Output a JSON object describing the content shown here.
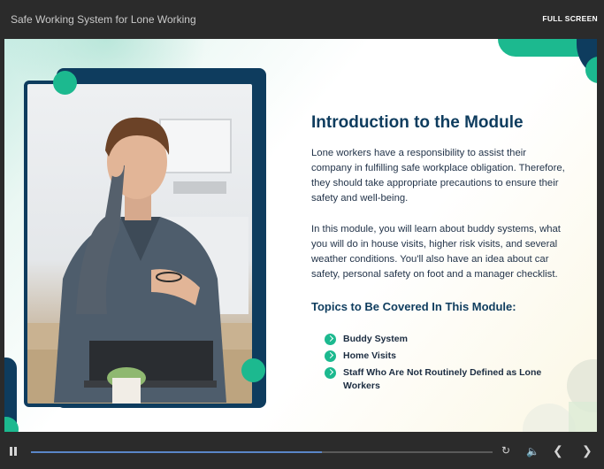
{
  "header": {
    "title": "Safe Working System for Lone Working",
    "fullscreen_label": "FULL SCREEN"
  },
  "slide": {
    "heading": "Introduction to the Module",
    "paragraph1": "Lone workers have a responsibility to assist their company in fulfilling safe workplace obligation. Therefore, they should take appropriate precautions to ensure their safety and well-being.",
    "paragraph2": "In this module, you will learn about buddy systems, what you will do in house visits, higher risk visits, and several weather conditions. You'll also have an idea about car safety, personal safety on foot and a manager checklist.",
    "topics_heading": "Topics to Be Covered In This Module:",
    "topics": [
      "Buddy System",
      "Home Visits",
      "Staff Who Are Not Routinely Defined as Lone Workers"
    ],
    "colors": {
      "navy": "#0e3c5e",
      "green": "#1cb98f"
    }
  },
  "player": {
    "progress_fraction": 0.63,
    "icons": [
      "pause-icon",
      "replay-icon",
      "volume-icon",
      "chevron-left-icon",
      "chevron-right-icon"
    ]
  }
}
